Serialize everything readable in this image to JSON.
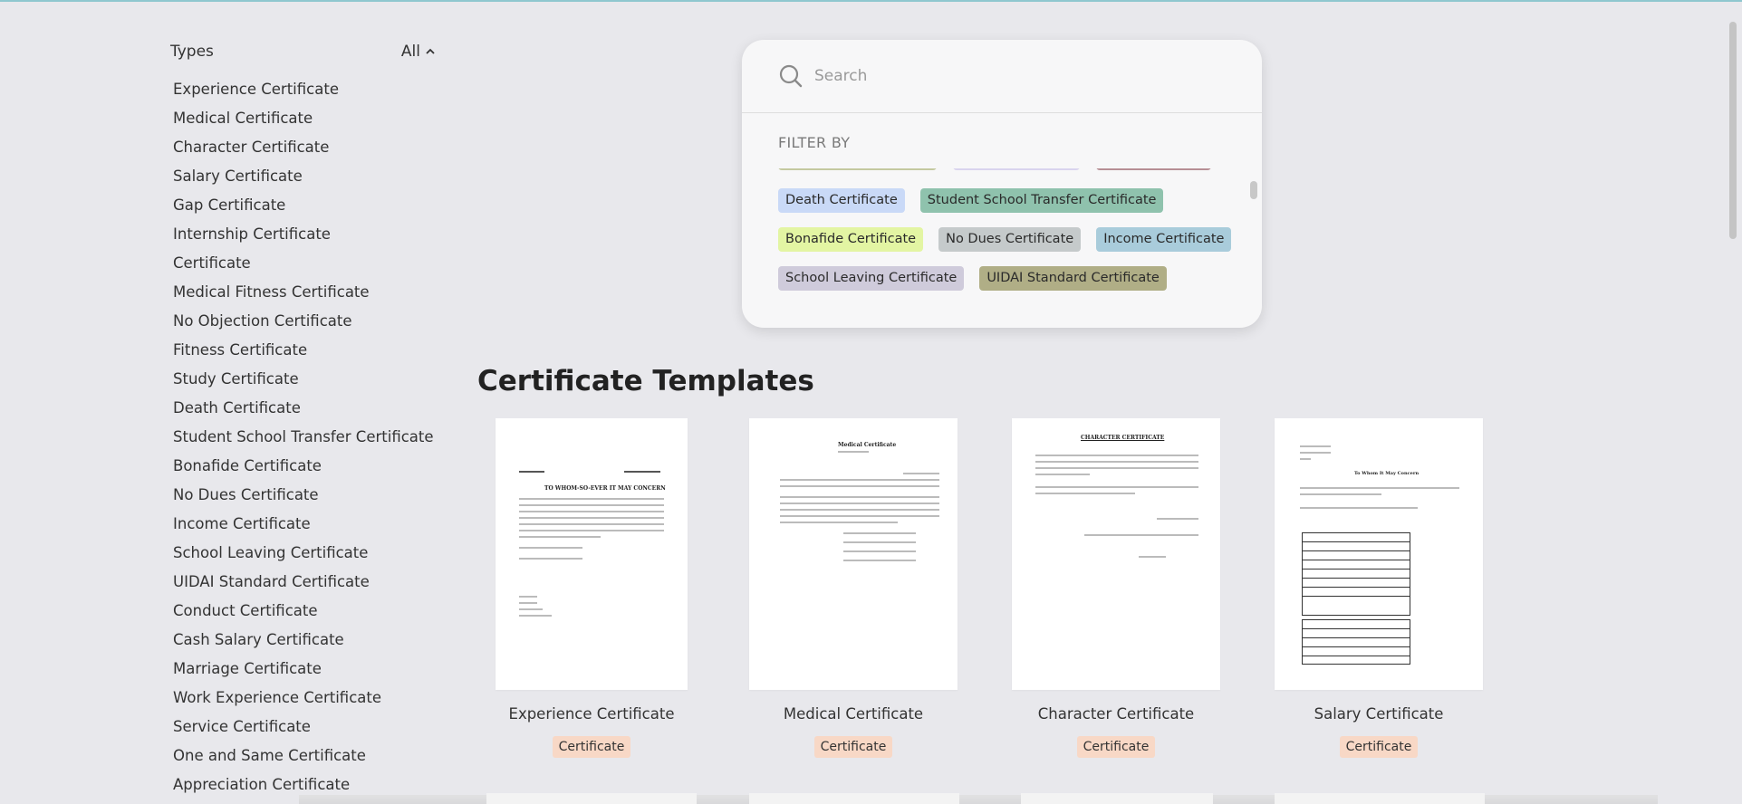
{
  "sidebar": {
    "title": "Types",
    "filter_label": "All",
    "items": [
      "Experience Certificate",
      "Medical Certificate",
      "Character Certificate",
      "Salary Certificate",
      "Gap Certificate",
      "Internship Certificate",
      "Certificate",
      "Medical Fitness Certificate",
      "No Objection Certificate",
      "Fitness Certificate",
      "Study Certificate",
      "Death Certificate",
      "Student School Transfer Certificate",
      "Bonafide Certificate",
      "No Dues Certificate",
      "Income Certificate",
      "School Leaving Certificate",
      "UIDAI Standard Certificate",
      "Conduct Certificate",
      "Cash Salary Certificate",
      "Marriage Certificate",
      "Work Experience Certificate",
      "Service Certificate",
      "One and Same Certificate",
      "Appreciation Certificate"
    ]
  },
  "search": {
    "placeholder": "Search",
    "filter_by": "FILTER BY",
    "chips": [
      [
        {
          "label": "Death Certificate",
          "color": "#c9d9f7"
        },
        {
          "label": "Student School Transfer Certificate",
          "color": "#8fc2ad"
        }
      ],
      [
        {
          "label": "Bonafide Certificate",
          "color": "#e3f5a3"
        },
        {
          "label": "No Dues Certificate",
          "color": "#c5cacb"
        },
        {
          "label": "Income Certificate",
          "color": "#a9ccdb"
        }
      ],
      [
        {
          "label": "School Leaving Certificate",
          "color": "#cfcbdb"
        },
        {
          "label": "UIDAI Standard Certificate",
          "color": "#b0ae86"
        }
      ]
    ]
  },
  "main": {
    "title": "Certificate Templates",
    "cards": [
      {
        "name": "Experience Certificate",
        "tag": "Certificate",
        "preview_title": "TO WHOM-SO-EVER IT MAY CONCERN"
      },
      {
        "name": "Medical Certificate",
        "tag": "Certificate",
        "preview_title": "Medical Certificate"
      },
      {
        "name": "Character Certificate",
        "tag": "Certificate",
        "preview_title": "CHARACTER CERTIFICATE"
      },
      {
        "name": "Salary Certificate",
        "tag": "Certificate",
        "preview_title": "To Whom It May Concern"
      }
    ]
  },
  "colors": {
    "accent_top": "#8fc7cf",
    "tag_bg": "#f8d8c6",
    "page_bg": "#e8e8ec"
  }
}
